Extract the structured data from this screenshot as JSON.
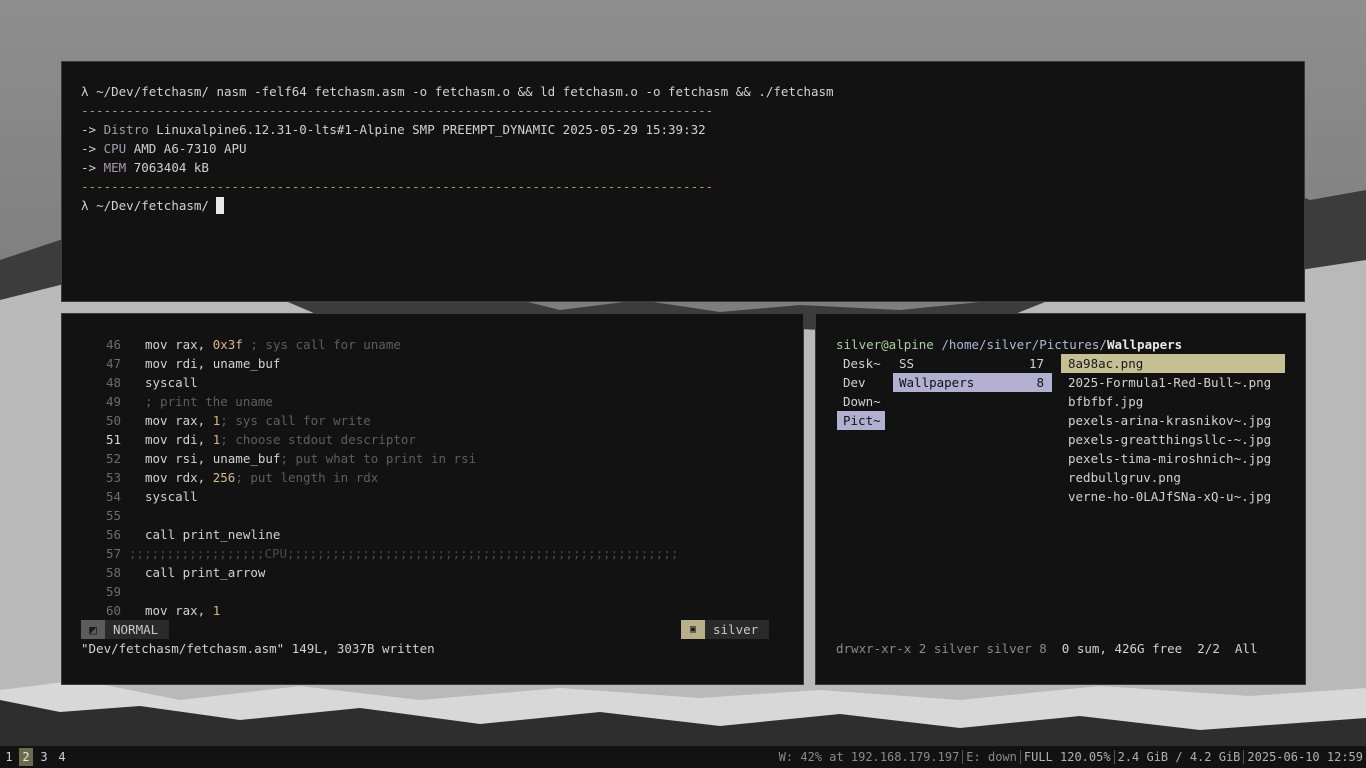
{
  "terminal": {
    "prompt_symbol": "λ",
    "cwd": "~/Dev/fetchasm/",
    "command": "nasm -felf64 fetchasm.asm -o fetchasm.o && ld fetchasm.o -o fetchasm && ./fetchasm",
    "separator": "------------------------------------------------------------------------------------",
    "arrow": "->",
    "info": [
      {
        "label": "Distro",
        "value": "Linuxalpine6.12.31-0-lts#1-Alpine SMP PREEMPT_DYNAMIC 2025-05-29 15:39:32"
      },
      {
        "label": "CPU",
        "value": "AMD A6-7310 APU"
      },
      {
        "label": "MEM",
        "value": "7063404 kB"
      }
    ]
  },
  "editor": {
    "lines": [
      {
        "n": "46",
        "code": "mov rax, ",
        "num": "0x3f",
        "comment": " ; sys call for uname"
      },
      {
        "n": "47",
        "code": "mov rdi, uname_buf",
        "num": "",
        "comment": ""
      },
      {
        "n": "48",
        "code": "syscall",
        "num": "",
        "comment": ""
      },
      {
        "n": "49",
        "code": "",
        "num": "",
        "comment": "; print the uname"
      },
      {
        "n": "50",
        "code": "mov rax, ",
        "num": "1",
        "comment": "; sys call for write"
      },
      {
        "n": "51",
        "code": "mov rdi, ",
        "num": "1",
        "comment": "; choose stdout descriptor"
      },
      {
        "n": "52",
        "code": "mov rsi, uname_buf",
        "num": "",
        "comment": "; put what to print in rsi"
      },
      {
        "n": "53",
        "code": "mov rdx, ",
        "num": "256",
        "comment": "; put length in rdx"
      },
      {
        "n": "54",
        "code": "syscall",
        "num": "",
        "comment": ""
      },
      {
        "n": "55",
        "code": "",
        "num": "",
        "comment": ""
      },
      {
        "n": "56",
        "code": "call print_newline",
        "num": "",
        "comment": ""
      },
      {
        "n": "57",
        "code": "",
        "num": "",
        "comment": ";;;;;;;;;;;;;;;;;;CPU;;;;;;;;;;;;;;;;;;;;;;;;;;;;;;;;;;;;;;;;;;;;;;;;;;;;"
      },
      {
        "n": "58",
        "code": "call print_arrow",
        "num": "",
        "comment": ""
      },
      {
        "n": "59",
        "code": "",
        "num": "",
        "comment": ""
      },
      {
        "n": "60",
        "code": "mov rax, ",
        "num": "1",
        "comment": ""
      }
    ],
    "mode": "NORMAL",
    "user": "silver",
    "message": "\"Dev/fetchasm/fetchasm.asm\" 149L, 3037B written"
  },
  "filemanager": {
    "user_host": "silver@alpine",
    "path": "/home/silver/Pictures/",
    "current": "Wallpapers",
    "parents": [
      "Desk~",
      "Dev",
      "Down~",
      "Pict~"
    ],
    "dirs": [
      {
        "name": "SS",
        "count": "17"
      },
      {
        "name": "Wallpapers",
        "count": "8"
      }
    ],
    "files": [
      "8a98ac.png",
      "2025-Formula1-Red-Bull~.png",
      "bfbfbf.jpg",
      "pexels-arina-krasnikov~.jpg",
      "pexels-greatthingsllc-~.jpg",
      "pexels-tima-miroshnich~.jpg",
      "redbullgruv.png",
      "verne-ho-0LAJfSNa-xQ-u~.jpg"
    ],
    "status_perms": "drwxr-xr-x 2 silver silver 8",
    "status_free": "0 sum, 426G free",
    "status_pos": "2/2",
    "status_all": "All"
  },
  "bar": {
    "workspaces": [
      "1",
      "2",
      "3",
      "4"
    ],
    "active_workspace": "2",
    "wifi": "W: 42% at 192.168.179.197",
    "ethernet": "E: down",
    "battery": "FULL 120.05%",
    "memory": "2.4 GiB / 4.2 GiB",
    "datetime": "2025-06-10 12:59"
  }
}
